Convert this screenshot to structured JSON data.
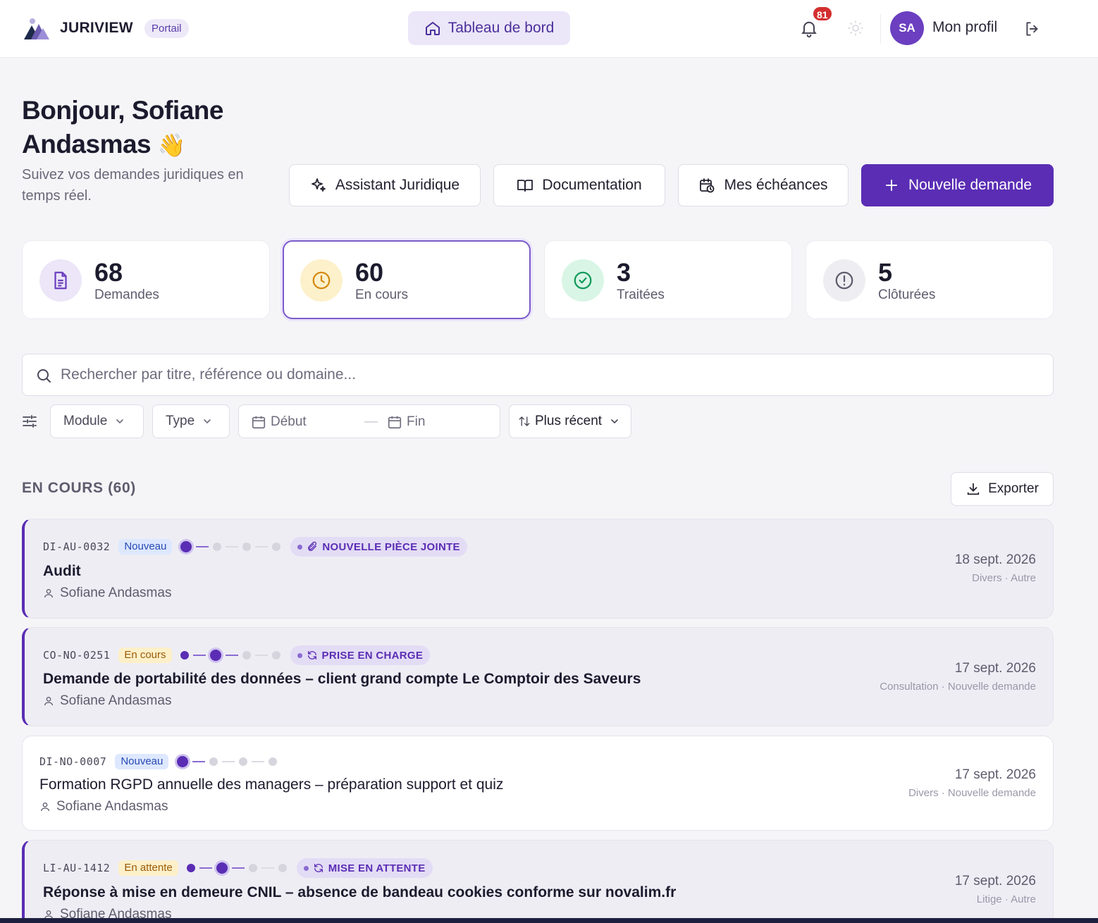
{
  "header": {
    "brand": "JURIVIEW",
    "portal_badge": "Portail",
    "nav_home": "Tableau de bord",
    "notifications_count": "81",
    "profile_initials": "SA",
    "profile_label": "Mon profil"
  },
  "greeting": {
    "title_line1": "Bonjour, Sofiane",
    "title_line2": "Andasmas",
    "emoji": "👋",
    "subtitle": "Suivez vos demandes juridiques en temps réel."
  },
  "actions": {
    "assistant": "Assistant Juridique",
    "documentation": "Documentation",
    "deadlines": "Mes échéances",
    "new_request": "Nouvelle demande"
  },
  "stats": [
    {
      "value": "68",
      "label": "Demandes",
      "icon": "file-icon",
      "color": "#6b3fc0"
    },
    {
      "value": "60",
      "label": "En cours",
      "icon": "clock-icon",
      "color": "#d48a12"
    },
    {
      "value": "3",
      "label": "Traitées",
      "icon": "check-circle-icon",
      "color": "#129a5c"
    },
    {
      "value": "5",
      "label": "Clôturées",
      "icon": "alert-circle-icon",
      "color": "#5e5c6d"
    }
  ],
  "search": {
    "placeholder": "Rechercher par titre, référence ou domaine..."
  },
  "filters": {
    "module": "Module",
    "type": "Type",
    "start": "Début",
    "separator": "—",
    "end": "Fin",
    "sort": "Plus récent"
  },
  "section": {
    "title": "EN COURS (60)",
    "export": "Exporter"
  },
  "requests": [
    {
      "ref": "DI-AU-0032",
      "status": "Nouveau",
      "event": "NOUVELLE PIÈCE JOINTE",
      "title": "Audit",
      "person": "Sofiane Andasmas",
      "date": "18 sept. 2026",
      "meta": "Divers · Autre"
    },
    {
      "ref": "CO-NO-0251",
      "status": "En cours",
      "event": "PRISE EN CHARGE",
      "title": "Demande de portabilité des données – client grand compte Le Comptoir des Saveurs",
      "person": "Sofiane Andasmas",
      "date": "17 sept. 2026",
      "meta": "Consultation · Nouvelle demande"
    },
    {
      "ref": "DI-NO-0007",
      "status": "Nouveau",
      "event": "",
      "title": "Formation RGPD annuelle des managers – préparation support et quiz",
      "person": "Sofiane Andasmas",
      "date": "17 sept. 2026",
      "meta": "Divers · Nouvelle demande"
    },
    {
      "ref": "LI-AU-1412",
      "status": "En attente",
      "event": "MISE EN ATTENTE",
      "title": "Réponse à mise en demeure CNIL – absence de bandeau cookies conforme sur novalim.fr",
      "person": "Sofiane Andasmas",
      "date": "17 sept. 2026",
      "meta": "Litige · Autre"
    }
  ]
}
